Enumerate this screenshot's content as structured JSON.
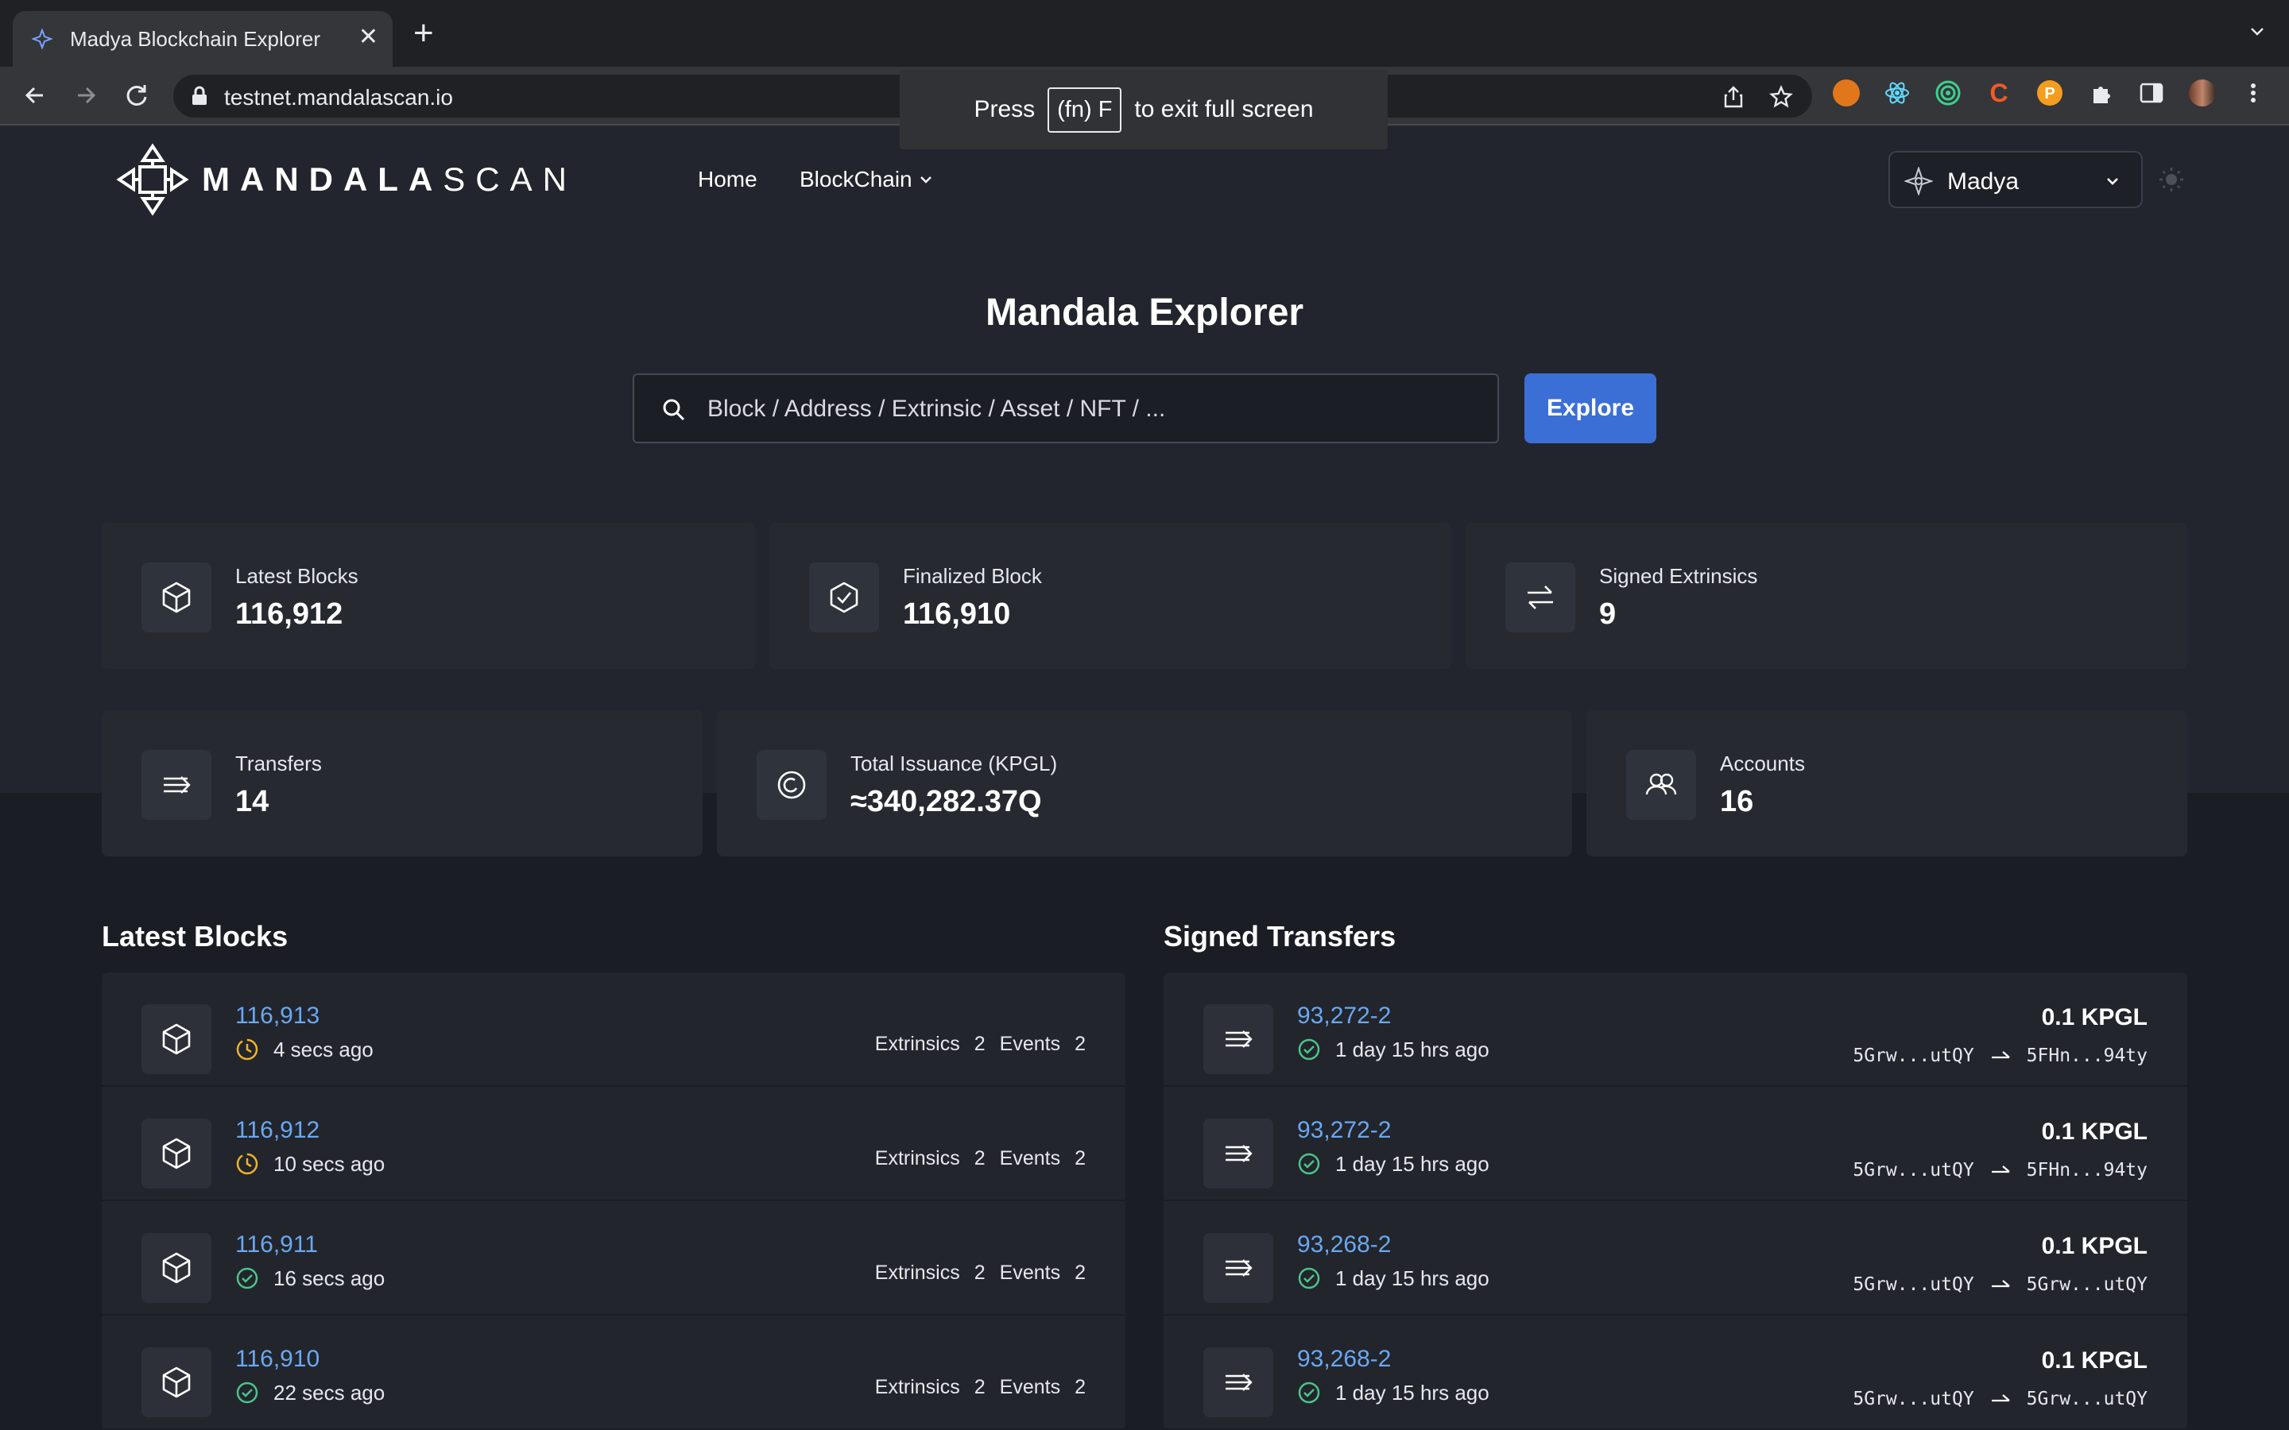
{
  "browser": {
    "tab_title": "Madya Blockchain Explorer",
    "url": "testnet.mandalascan.io",
    "fullscreen_hint": {
      "press": "Press",
      "key": "(fn) F",
      "rest": "to exit full screen"
    }
  },
  "header": {
    "logo_bold": "MANDALA",
    "logo_light": "SCAN",
    "nav_home": "Home",
    "nav_blockchain": "BlockChain",
    "network": "Madya"
  },
  "hero": {
    "title": "Mandala Explorer",
    "search_placeholder": "Block / Address / Extrinsic / Asset / NFT / ...",
    "explore_label": "Explore"
  },
  "stats": {
    "latest_blocks": {
      "label": "Latest Blocks",
      "value": "116,912",
      "icon": "cube-icon"
    },
    "finalized_block": {
      "label": "Finalized Block",
      "value": "116,910",
      "icon": "cube-check-icon"
    },
    "signed_extrinsics": {
      "label": "Signed Extrinsics",
      "value": "9",
      "icon": "swap-icon"
    },
    "transfers": {
      "label": "Transfers",
      "value": "14",
      "icon": "transfer-icon"
    },
    "total_issuance": {
      "label": "Total Issuance (KPGL)",
      "value": "≈340,282.37Q",
      "icon": "coin-icon"
    },
    "accounts": {
      "label": "Accounts",
      "value": "16",
      "icon": "users-icon"
    }
  },
  "latest_blocks": {
    "title": "Latest Blocks",
    "extrinsics_label": "Extrinsics",
    "events_label": "Events",
    "rows": [
      {
        "block": "116,913",
        "time": "4 secs ago",
        "status": "pending",
        "extrinsics": "2",
        "events": "2"
      },
      {
        "block": "116,912",
        "time": "10 secs ago",
        "status": "pending",
        "extrinsics": "2",
        "events": "2"
      },
      {
        "block": "116,911",
        "time": "16 secs ago",
        "status": "finalized",
        "extrinsics": "2",
        "events": "2"
      },
      {
        "block": "116,910",
        "time": "22 secs ago",
        "status": "finalized",
        "extrinsics": "2",
        "events": "2"
      }
    ]
  },
  "signed_transfers": {
    "title": "Signed Transfers",
    "rows": [
      {
        "id": "93,272-2",
        "time": "1 day 15 hrs ago",
        "amount": "0.1 KPGL",
        "from": "5Grw...utQY",
        "to": "5FHn...94ty"
      },
      {
        "id": "93,272-2",
        "time": "1 day 15 hrs ago",
        "amount": "0.1 KPGL",
        "from": "5Grw...utQY",
        "to": "5FHn...94ty"
      },
      {
        "id": "93,268-2",
        "time": "1 day 15 hrs ago",
        "amount": "0.1 KPGL",
        "from": "5Grw...utQY",
        "to": "5Grw...utQY"
      },
      {
        "id": "93,268-2",
        "time": "1 day 15 hrs ago",
        "amount": "0.1 KPGL",
        "from": "5Grw...utQY",
        "to": "5Grw...utQY"
      }
    ]
  },
  "colors": {
    "accent": "#3b6fd6",
    "link": "#6aa8f0",
    "pending": "#f0b429",
    "finalized": "#4cc38a"
  }
}
